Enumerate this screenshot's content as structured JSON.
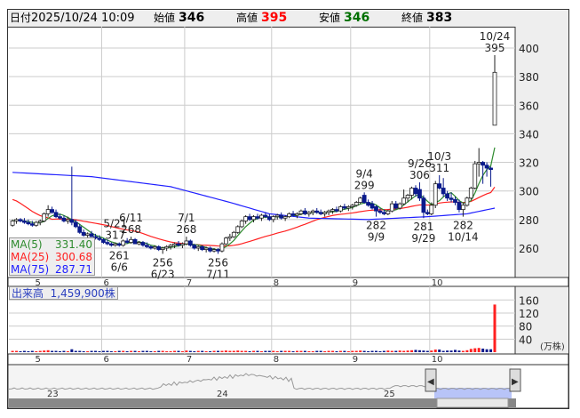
{
  "header": {
    "date_label": "日付",
    "datetime": "2025/10/24 10:09",
    "open_label": "始値",
    "open": "346",
    "high_label": "高値",
    "high": "395",
    "low_label": "安値",
    "low": "346",
    "close_label": "終値",
    "close": "383"
  },
  "colors": {
    "up_body": "#ffffff",
    "down_body": "#0a1a8c",
    "ma5": "#2e8b2e",
    "ma25": "#ff2020",
    "ma75": "#2020ff",
    "vol_up": "#ff2020",
    "vol_down": "#0a1a8c",
    "vol_flat": "#888888",
    "high_text": "#ff0000",
    "low_text": "#007000"
  },
  "legend": [
    {
      "name": "MA(5)",
      "value": "331.40"
    },
    {
      "name": "MA(25)",
      "value": "300.68"
    },
    {
      "name": "MA(75)",
      "value": "287.71"
    }
  ],
  "volume_label": {
    "title": "出来高",
    "value": "1,459,900株"
  },
  "price_axis": {
    "ticks": [
      400,
      380,
      360,
      340,
      320,
      300,
      280,
      260
    ]
  },
  "volume_axis": {
    "ticks": [
      160,
      120,
      80,
      40
    ],
    "unit": "(万株)"
  },
  "months": [
    {
      "label": "5",
      "index": 3
    },
    {
      "label": "6",
      "index": 23
    },
    {
      "label": "7",
      "index": 44
    },
    {
      "label": "8",
      "index": 66
    },
    {
      "label": "9",
      "index": 86
    },
    {
      "label": "10",
      "index": 106
    }
  ],
  "navigator": {
    "years": [
      "23",
      "24",
      "25"
    ]
  },
  "annotations": [
    {
      "index": 26,
      "date": "5/21",
      "value": "317",
      "pos": "above"
    },
    {
      "index": 27,
      "date": "6/6",
      "value": "261",
      "pos": "below"
    },
    {
      "index": 30,
      "date": "6/11",
      "value": "268",
      "pos": "above"
    },
    {
      "index": 38,
      "date": "6/23",
      "value": "256",
      "pos": "below"
    },
    {
      "index": 44,
      "date": "7/1",
      "value": "268",
      "pos": "above"
    },
    {
      "index": 52,
      "date": "7/11",
      "value": "256",
      "pos": "below"
    },
    {
      "index": 89,
      "date": "9/4",
      "value": "299",
      "pos": "above"
    },
    {
      "index": 92,
      "date": "9/9",
      "value": "282",
      "pos": "below"
    },
    {
      "index": 103,
      "date": "9/26",
      "value": "306",
      "pos": "above"
    },
    {
      "index": 104,
      "date": "9/29",
      "value": "281",
      "pos": "below"
    },
    {
      "index": 108,
      "date": "10/3",
      "value": "311",
      "pos": "above"
    },
    {
      "index": 114,
      "date": "10/14",
      "value": "282",
      "pos": "below"
    },
    {
      "index": 122,
      "date": "10/24",
      "value": "395",
      "pos": "above"
    }
  ],
  "chart_data": {
    "type": "candlestick",
    "ylim": [
      250,
      410
    ],
    "ohlc": [
      [
        276,
        280,
        275,
        279
      ],
      [
        279,
        281,
        277,
        280
      ],
      [
        280,
        281,
        278,
        279
      ],
      [
        279,
        281,
        277,
        278
      ],
      [
        278,
        280,
        276,
        277
      ],
      [
        277,
        279,
        275,
        276
      ],
      [
        276,
        279,
        275,
        278
      ],
      [
        278,
        280,
        276,
        279
      ],
      [
        279,
        285,
        278,
        284
      ],
      [
        284,
        290,
        282,
        287
      ],
      [
        287,
        289,
        284,
        285
      ],
      [
        285,
        287,
        281,
        282
      ],
      [
        282,
        284,
        280,
        281
      ],
      [
        281,
        283,
        278,
        279
      ],
      [
        279,
        282,
        277,
        280
      ],
      [
        280,
        317,
        276,
        278
      ],
      [
        278,
        280,
        274,
        275
      ],
      [
        275,
        277,
        270,
        271
      ],
      [
        271,
        273,
        268,
        269
      ],
      [
        269,
        271,
        267,
        270
      ],
      [
        270,
        272,
        268,
        268
      ],
      [
        268,
        270,
        266,
        267
      ],
      [
        267,
        269,
        265,
        266
      ],
      [
        266,
        267,
        263,
        264
      ],
      [
        264,
        266,
        262,
        263
      ],
      [
        263,
        264,
        261,
        262
      ],
      [
        262,
        264,
        261,
        263
      ],
      [
        263,
        264,
        261,
        262
      ],
      [
        262,
        266,
        261,
        265
      ],
      [
        265,
        267,
        263,
        264
      ],
      [
        264,
        268,
        263,
        266
      ],
      [
        266,
        267,
        263,
        263
      ],
      [
        263,
        265,
        262,
        264
      ],
      [
        264,
        265,
        261,
        262
      ],
      [
        262,
        264,
        260,
        261
      ],
      [
        261,
        262,
        259,
        260
      ],
      [
        260,
        262,
        259,
        261
      ],
      [
        261,
        262,
        258,
        259
      ],
      [
        259,
        261,
        256,
        260
      ],
      [
        260,
        262,
        258,
        261
      ],
      [
        261,
        263,
        259,
        262
      ],
      [
        262,
        264,
        260,
        263
      ],
      [
        263,
        265,
        261,
        262
      ],
      [
        262,
        264,
        260,
        263
      ],
      [
        263,
        268,
        262,
        265
      ],
      [
        265,
        266,
        261,
        262
      ],
      [
        262,
        263,
        259,
        260
      ],
      [
        260,
        262,
        258,
        261
      ],
      [
        261,
        262,
        258,
        259
      ],
      [
        259,
        261,
        257,
        260
      ],
      [
        260,
        261,
        257,
        258
      ],
      [
        258,
        260,
        257,
        259
      ],
      [
        259,
        260,
        256,
        258
      ],
      [
        258,
        264,
        257,
        263
      ],
      [
        263,
        268,
        262,
        267
      ],
      [
        267,
        270,
        265,
        268
      ],
      [
        268,
        272,
        267,
        271
      ],
      [
        271,
        276,
        270,
        275
      ],
      [
        275,
        280,
        274,
        279
      ],
      [
        279,
        283,
        277,
        282
      ],
      [
        282,
        284,
        279,
        280
      ],
      [
        280,
        283,
        278,
        282
      ],
      [
        282,
        284,
        280,
        281
      ],
      [
        281,
        284,
        279,
        283
      ],
      [
        283,
        285,
        281,
        282
      ],
      [
        282,
        284,
        279,
        280
      ],
      [
        280,
        283,
        278,
        282
      ],
      [
        282,
        284,
        280,
        283
      ],
      [
        283,
        285,
        280,
        281
      ],
      [
        281,
        283,
        279,
        282
      ],
      [
        282,
        285,
        281,
        284
      ],
      [
        284,
        286,
        282,
        283
      ],
      [
        283,
        285,
        281,
        284
      ],
      [
        284,
        287,
        283,
        286
      ],
      [
        286,
        288,
        283,
        284
      ],
      [
        284,
        286,
        282,
        285
      ],
      [
        285,
        287,
        283,
        286
      ],
      [
        286,
        288,
        284,
        285
      ],
      [
        285,
        287,
        283,
        284
      ],
      [
        284,
        286,
        282,
        285
      ],
      [
        285,
        287,
        283,
        286
      ],
      [
        286,
        288,
        284,
        287
      ],
      [
        287,
        289,
        285,
        286
      ],
      [
        286,
        290,
        285,
        289
      ],
      [
        289,
        291,
        287,
        288
      ],
      [
        288,
        290,
        286,
        289
      ],
      [
        289,
        291,
        287,
        290
      ],
      [
        290,
        293,
        289,
        292
      ],
      [
        292,
        296,
        291,
        295
      ],
      [
        297,
        299,
        291,
        292
      ],
      [
        292,
        294,
        289,
        290
      ],
      [
        291,
        293,
        287,
        288
      ],
      [
        289,
        290,
        282,
        286
      ],
      [
        286,
        288,
        284,
        285
      ],
      [
        285,
        287,
        283,
        284
      ],
      [
        284,
        287,
        283,
        286
      ],
      [
        286,
        293,
        285,
        291
      ],
      [
        291,
        293,
        287,
        288
      ],
      [
        288,
        292,
        287,
        291
      ],
      [
        291,
        301,
        290,
        295
      ],
      [
        295,
        298,
        292,
        297
      ],
      [
        297,
        303,
        294,
        302
      ],
      [
        302,
        304,
        296,
        298
      ],
      [
        301,
        306,
        293,
        295
      ],
      [
        295,
        297,
        281,
        285
      ],
      [
        285,
        287,
        283,
        284
      ],
      [
        284,
        292,
        283,
        290
      ],
      [
        290,
        307,
        288,
        305
      ],
      [
        305,
        311,
        301,
        302
      ],
      [
        302,
        309,
        296,
        298
      ],
      [
        298,
        300,
        293,
        295
      ],
      [
        295,
        299,
        292,
        294
      ],
      [
        294,
        296,
        290,
        292
      ],
      [
        292,
        294,
        285,
        287
      ],
      [
        287,
        292,
        282,
        290
      ],
      [
        290,
        296,
        289,
        295
      ],
      [
        295,
        303,
        294,
        302
      ],
      [
        302,
        321,
        301,
        319
      ],
      [
        319,
        330,
        310,
        320
      ],
      [
        320,
        321,
        305,
        318
      ],
      [
        318,
        320,
        310,
        316
      ],
      [
        316,
        317,
        303,
        315
      ],
      [
        346,
        395,
        346,
        383
      ]
    ],
    "ma75": [
      [
        0,
        313
      ],
      [
        20,
        310
      ],
      [
        40,
        303
      ],
      [
        55,
        292
      ],
      [
        65,
        284
      ],
      [
        75,
        281
      ],
      [
        90,
        280
      ],
      [
        105,
        282
      ],
      [
        115,
        284
      ],
      [
        122,
        288
      ]
    ],
    "volume": [
      4,
      4,
      3,
      4,
      3,
      4,
      3,
      4,
      5,
      6,
      4,
      4,
      3,
      4,
      3,
      9,
      4,
      4,
      3,
      3,
      4,
      4,
      3,
      4,
      4,
      3,
      3,
      4,
      4,
      3,
      4,
      4,
      3,
      4,
      4,
      3,
      3,
      4,
      4,
      3,
      3,
      4,
      4,
      3,
      5,
      4,
      3,
      4,
      4,
      3,
      3,
      4,
      4,
      4,
      5,
      4,
      4,
      5,
      4,
      4,
      3,
      4,
      4,
      3,
      4,
      4,
      4,
      3,
      4,
      4,
      4,
      3,
      4,
      4,
      4,
      3,
      3,
      4,
      4,
      3,
      4,
      4,
      3,
      4,
      4,
      3,
      4,
      4,
      5,
      4,
      3,
      4,
      4,
      3,
      4,
      5,
      4,
      4,
      5,
      4,
      5,
      6,
      7,
      6,
      5,
      4,
      5,
      8,
      8,
      4,
      5,
      5,
      7,
      5,
      4,
      6,
      10,
      12,
      13,
      11,
      9,
      9,
      146
    ],
    "volume_ylim": [
      0,
      170
    ]
  }
}
